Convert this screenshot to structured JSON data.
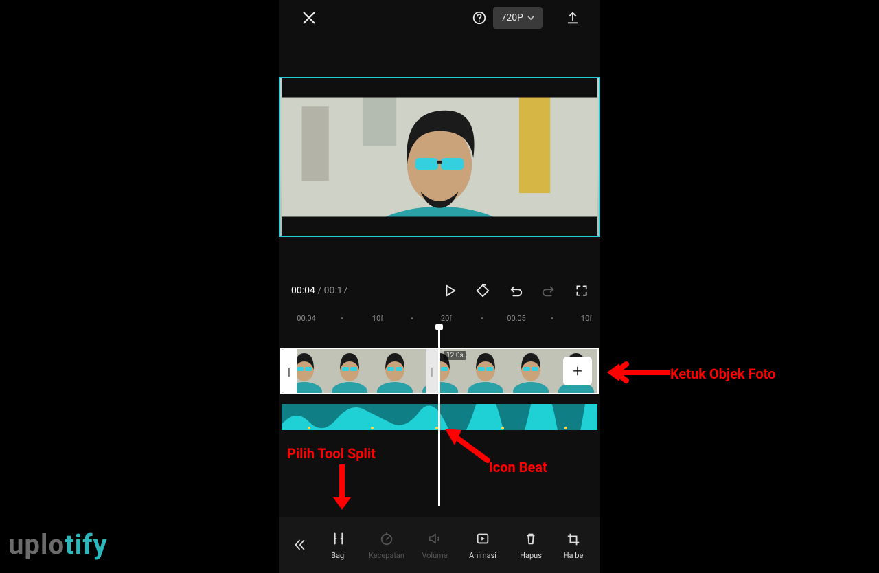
{
  "topbar": {
    "resolution_label": "720P"
  },
  "playback": {
    "current": "00:04",
    "separator": " / ",
    "duration": "00:17"
  },
  "ruler": {
    "ticks": [
      "00:04",
      "10f",
      "20f",
      "00:05",
      "10f"
    ]
  },
  "timeline": {
    "clip_duration_badge": "12.0s",
    "left_handle_glyph": "|",
    "mid_handle_glyph": "|",
    "add_glyph": "+"
  },
  "tools": {
    "back": "«",
    "items": [
      {
        "label": "Bagi",
        "disabled": false
      },
      {
        "label": "Kecepatan",
        "disabled": true
      },
      {
        "label": "Volume",
        "disabled": true
      },
      {
        "label": "Animasi",
        "disabled": false
      },
      {
        "label": "Hapus",
        "disabled": false
      },
      {
        "label": "Ha be",
        "disabled": false
      }
    ]
  },
  "annotations": {
    "tap_photo": "Ketuk Objek Foto",
    "pick_split": "Pilih Tool Split",
    "icon_beat": "Icon Beat"
  },
  "watermark": {
    "part1": "uplo",
    "part2": "tify"
  },
  "colors": {
    "accent": "#21cfd0",
    "audio": "#17b8bd",
    "anno": "#f00"
  }
}
